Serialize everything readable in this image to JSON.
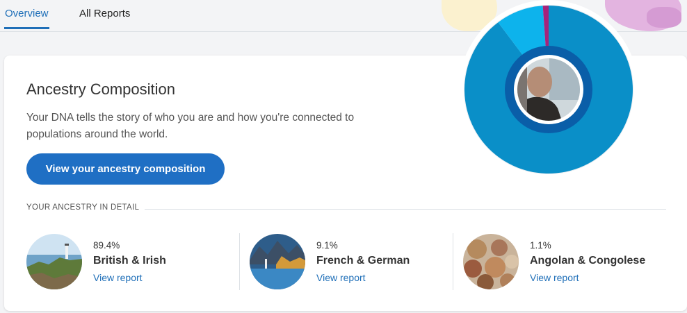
{
  "tabs": [
    {
      "label": "Overview",
      "active": true
    },
    {
      "label": "All Reports",
      "active": false
    }
  ],
  "card": {
    "title": "Ancestry Composition",
    "description": "Your DNA tells the story of who you are and how you're connected to populations around the world.",
    "cta_label": "View your ancestry composition",
    "section_label": "YOUR ANCESTRY IN DETAIL"
  },
  "ancestry": [
    {
      "percent": "89.4%",
      "name": "British & Irish",
      "link": "View report",
      "value": 89.4,
      "icon": "coastal-lighthouse-photo"
    },
    {
      "percent": "9.1%",
      "name": "French & German",
      "link": "View report",
      "value": 9.1,
      "icon": "alpine-lake-village-photo"
    },
    {
      "percent": "1.1%",
      "name": "Angolan & Congolese",
      "link": "View report",
      "value": 1.1,
      "icon": "woven-baskets-photo"
    }
  ],
  "colors": {
    "accent": "#1f6fc4",
    "link": "#1f6fb8",
    "british_irish": "#0a8fc8",
    "french_german": "#0db3ec",
    "angolan_congolese": "#a6237b",
    "inner_ring": "#0a5ea8"
  },
  "chart_data": {
    "type": "pie",
    "categories": [
      "British & Irish",
      "French & German",
      "Angolan & Congolese"
    ],
    "values": [
      89.4,
      9.1,
      1.1
    ]
  }
}
